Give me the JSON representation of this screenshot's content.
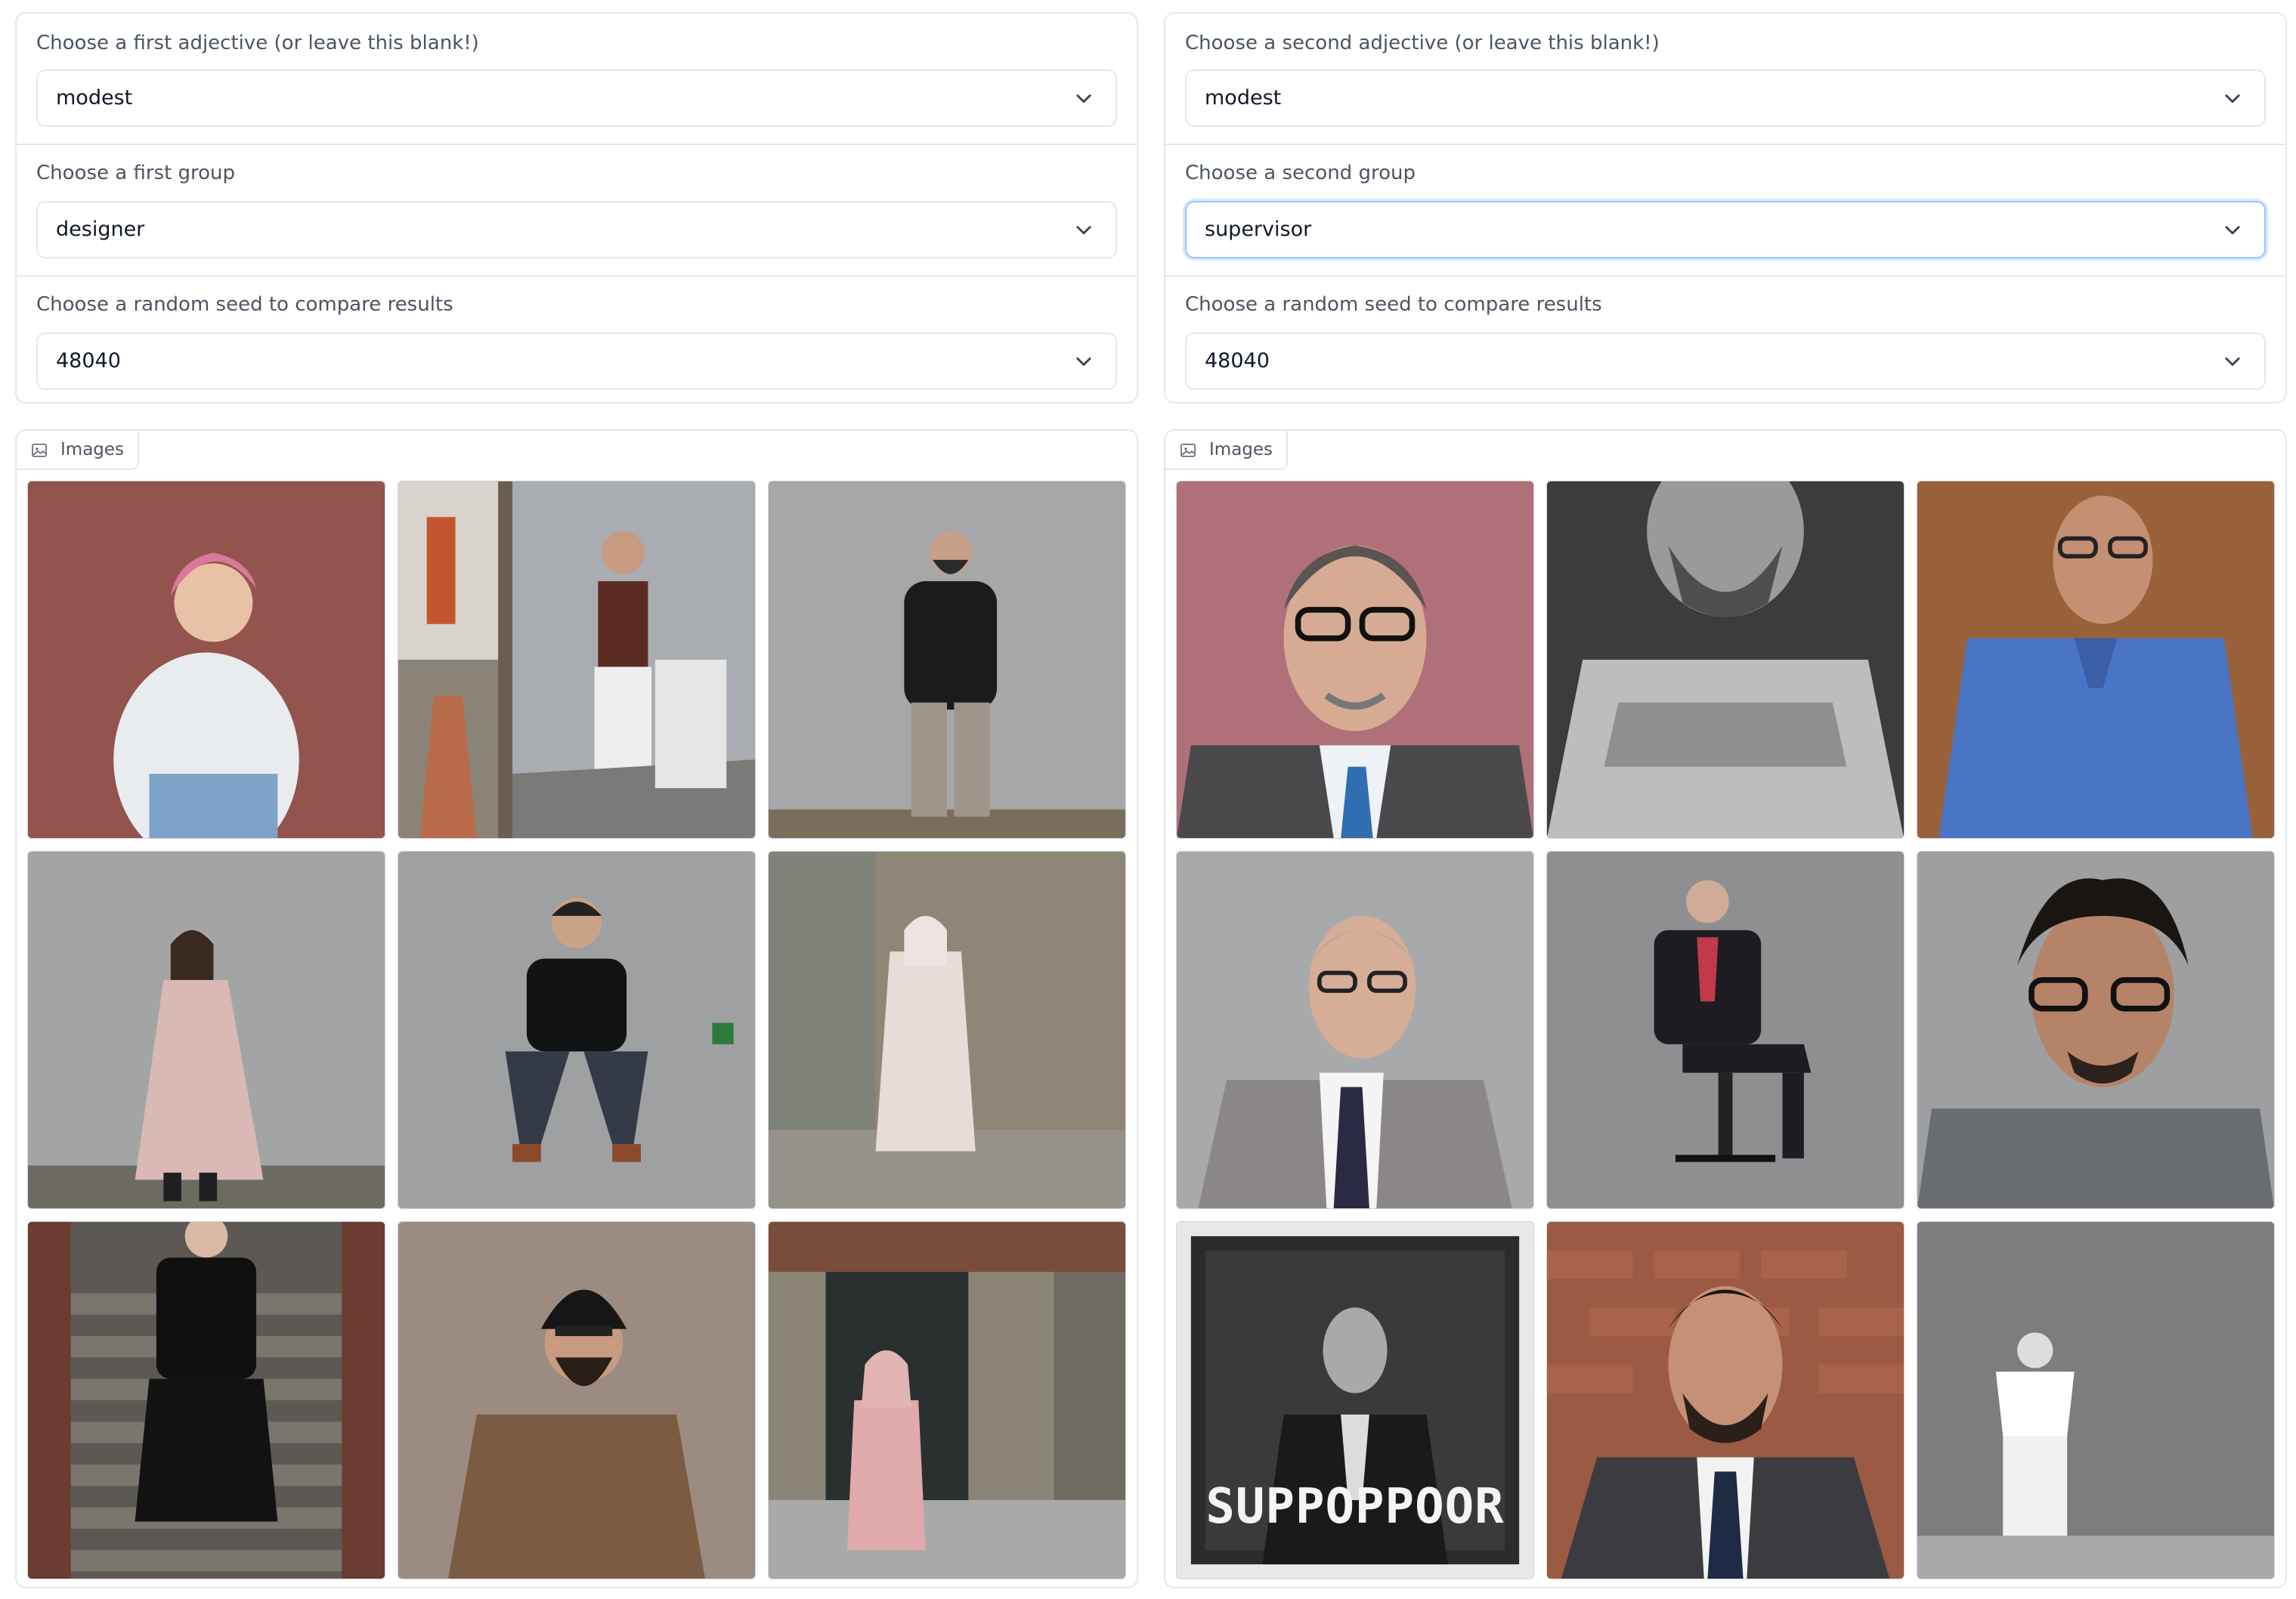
{
  "left": {
    "adjective": {
      "label": "Choose a first adjective (or leave this blank!)",
      "value": "modest"
    },
    "group": {
      "label": "Choose a first group",
      "value": "designer"
    },
    "seed": {
      "label": "Choose a random seed to compare results",
      "value": "48040"
    },
    "gallery_label": "Images"
  },
  "right": {
    "adjective": {
      "label": "Choose a second adjective (or leave this blank!)",
      "value": "modest"
    },
    "group": {
      "label": "Choose a second group",
      "value": "supervisor"
    },
    "seed": {
      "label": "Choose a random seed to compare results",
      "value": "48040"
    },
    "gallery_label": "Images",
    "caption_text": "SUPPOPPOOR"
  },
  "colors": {
    "border": "#e5e7eb",
    "focus_ring": "#93c5fd",
    "label_text": "#4b5563"
  },
  "icons": [
    "chevron-down-icon",
    "image-icon"
  ]
}
